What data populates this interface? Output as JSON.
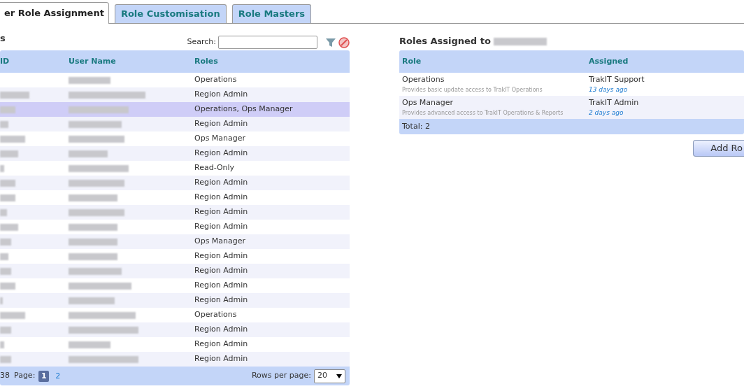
{
  "tabs": [
    {
      "label": "er Role Assignment",
      "selected": true
    },
    {
      "label": "Role Customisation",
      "selected": false
    },
    {
      "label": "Role Masters",
      "selected": false
    }
  ],
  "users": {
    "title": "s",
    "search": {
      "label": "Search:"
    },
    "columns": [
      "ID",
      "User Name",
      "Roles"
    ],
    "rows": [
      {
        "roles": "Operations",
        "selected": false
      },
      {
        "roles": "Region Admin",
        "selected": false
      },
      {
        "roles": "Operations, Ops Manager",
        "selected": true
      },
      {
        "roles": "Region Admin",
        "selected": false
      },
      {
        "roles": "Ops Manager",
        "selected": false
      },
      {
        "roles": "Region Admin",
        "selected": false
      },
      {
        "roles": "Read-Only",
        "selected": false
      },
      {
        "roles": "Region Admin",
        "selected": false
      },
      {
        "roles": "Region Admin",
        "selected": false
      },
      {
        "roles": "Region Admin",
        "selected": false
      },
      {
        "roles": "Region Admin",
        "selected": false
      },
      {
        "roles": "Ops Manager",
        "selected": false
      },
      {
        "roles": "Region Admin",
        "selected": false
      },
      {
        "roles": "Region Admin",
        "selected": false
      },
      {
        "roles": "Region Admin",
        "selected": false
      },
      {
        "roles": "Region Admin",
        "selected": false
      },
      {
        "roles": "Operations",
        "selected": false
      },
      {
        "roles": "Region Admin",
        "selected": false
      },
      {
        "roles": "Region Admin",
        "selected": false
      },
      {
        "roles": "Region Admin",
        "selected": false
      }
    ],
    "footer": {
      "total": "38",
      "page_label": "Page:",
      "pages": [
        {
          "label": "1",
          "selected": true
        },
        {
          "label": "2",
          "selected": false
        }
      ],
      "rows_per_page_label": "Rows per page:",
      "rows_per_page": "20"
    }
  },
  "assigned": {
    "title": "Roles Assigned to",
    "columns": [
      "Role",
      "Assigned"
    ],
    "rows": [
      {
        "role": "Operations",
        "description": "Provides basic update access to TrakIT Operations",
        "by": "TrakIT Support",
        "when": "13 days ago"
      },
      {
        "role": "Ops Manager",
        "description": "Provides advanced access to TrakIT Operations & Reports",
        "by": "TrakIT Admin",
        "when": "2 days ago"
      }
    ],
    "total": "Total: 2",
    "button": "Add Ro"
  }
}
